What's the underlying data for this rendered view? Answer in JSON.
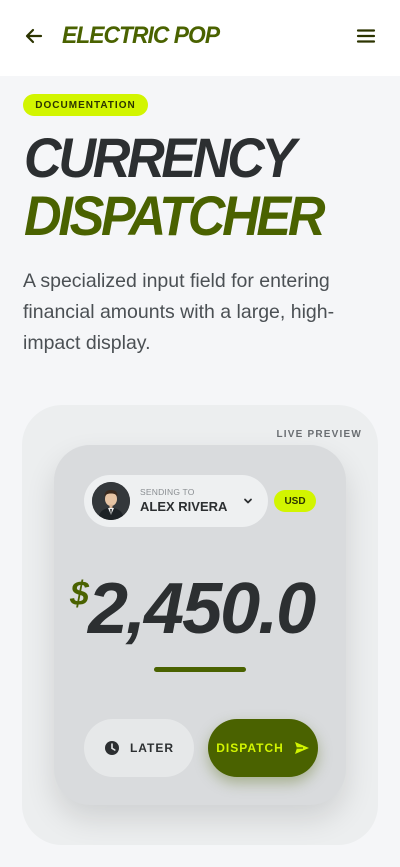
{
  "header": {
    "brand": "ELECTRIC POP"
  },
  "badge": "DOCUMENTATION",
  "title": {
    "line1": "CURRENCY",
    "line2": "DISPATCHER"
  },
  "description": "A specialized input field for entering financial amounts with a large, high-impact display.",
  "preview": {
    "label": "LIVE PREVIEW",
    "recipient": {
      "label": "SENDING TO",
      "name": "ALEX RIVERA"
    },
    "currency": "USD",
    "symbol": "$",
    "amount": "2,450.00",
    "later_label": "LATER",
    "dispatch_label": "DISPATCH"
  },
  "colors": {
    "accent": "#d2f500",
    "brand": "#4a6200",
    "text": "#2c2f31"
  },
  "icons": {
    "back": "arrow-left-icon",
    "menu": "hamburger-menu-icon",
    "chevron": "chevron-down-icon",
    "later": "clock-icon",
    "dispatch": "send-icon"
  }
}
